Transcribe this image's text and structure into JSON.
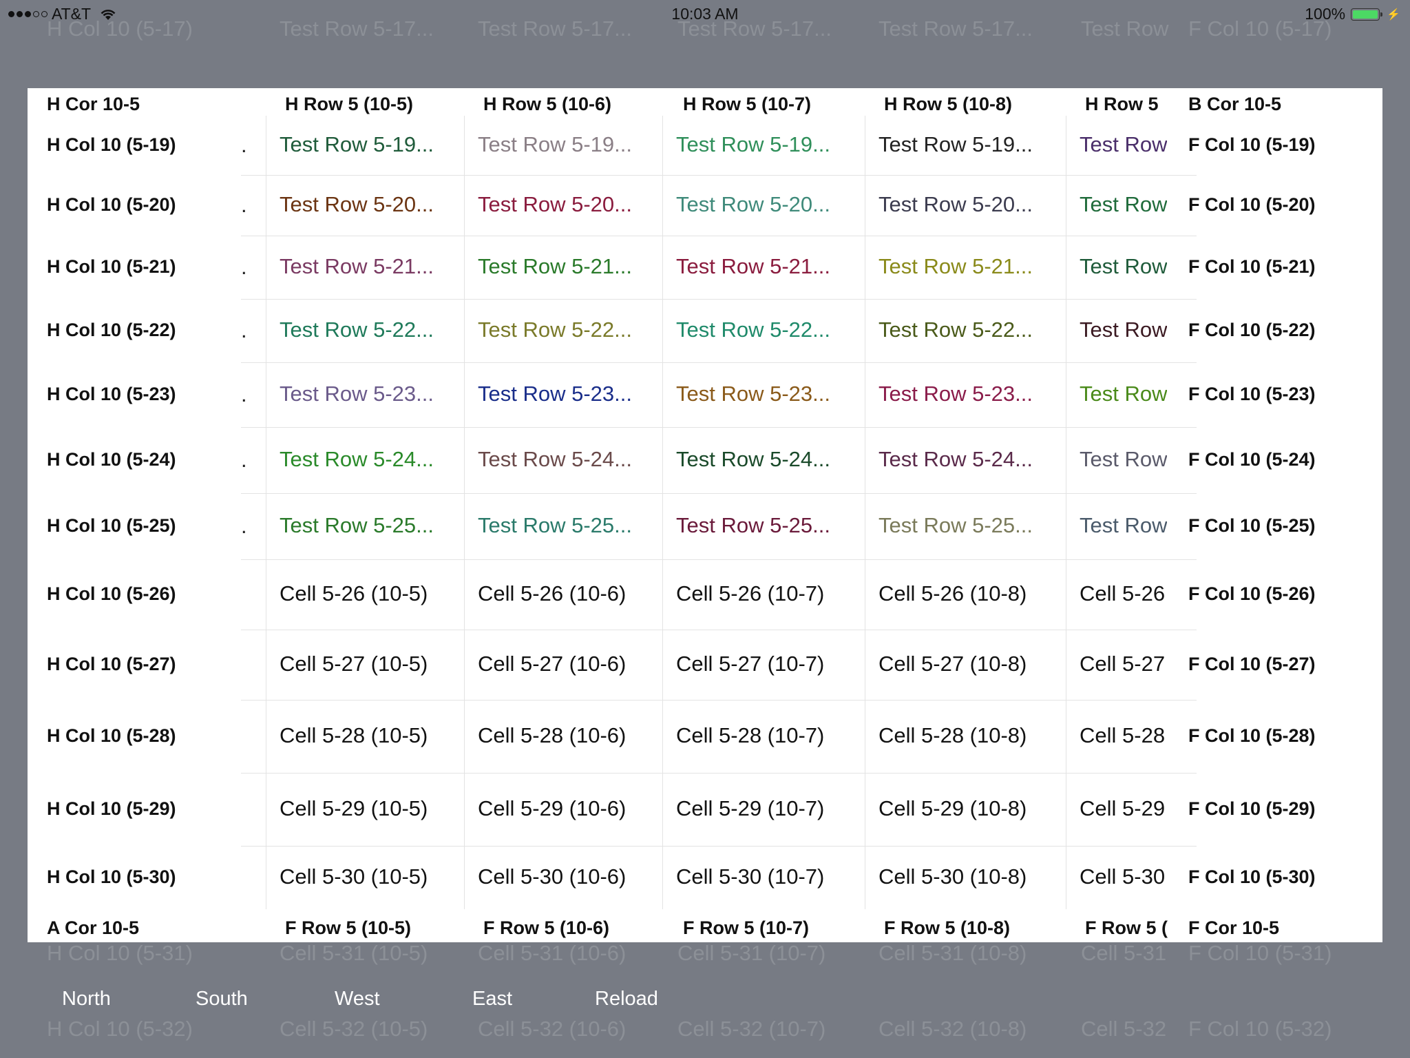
{
  "status": {
    "carrier": "AT&T",
    "time": "10:03 AM",
    "battery": "100%"
  },
  "ghost": {
    "top_left": "H Col 10 (5-17)",
    "top_cells": [
      "Test Row 5-17...",
      "Test Row 5-17...",
      "Test Row 5-17...",
      "Test Row 5-17..."
    ],
    "top_partial": "Test Row",
    "top_right": "F Col 10 (5-17)",
    "bottom1_left": "H Col 10 (5-31)",
    "bottom1_cells": [
      "Cell 5-31 (10-5)",
      "Cell 5-31 (10-6)",
      "Cell 5-31 (10-7)",
      "Cell 5-31 (10-8)"
    ],
    "bottom1_partial": "Cell 5-31",
    "bottom1_right": "F Col 10 (5-31)",
    "bottom2_left": "H Col 10 (5-32)",
    "bottom2_cells": [
      "Cell 5-32 (10-5)",
      "Cell 5-32 (10-6)",
      "Cell 5-32 (10-7)",
      "Cell 5-32 (10-8)"
    ],
    "bottom2_partial": "Cell 5-32",
    "bottom2_right": "F Col 10 (5-32)"
  },
  "grid": {
    "top_left_corner": "H Cor 10-5",
    "top_right_corner": "B Cor 10-5",
    "bottom_left_corner": "A Cor 10-5",
    "bottom_right_corner": "F Cor 10-5",
    "header_columns": [
      "H Row 5 (10-5)",
      "H Row 5 (10-6)",
      "H Row 5 (10-7)",
      "H Row 5 (10-8)",
      "H Row 5"
    ],
    "footer_columns": [
      "F Row 5 (10-5)",
      "F Row 5 (10-6)",
      "F Row 5 (10-7)",
      "F Row 5 (10-8)",
      "F Row 5 ("
    ],
    "row_headers": [
      "H Col 10 (5-19)",
      "H Col 10 (5-20)",
      "H Col 10 (5-21)",
      "H Col 10 (5-22)",
      "H Col 10 (5-23)",
      "H Col 10 (5-24)",
      "H Col 10 (5-25)",
      "H Col 10 (5-26)",
      "H Col 10 (5-27)",
      "H Col 10 (5-28)",
      "H Col 10 (5-29)",
      "H Col 10 (5-30)"
    ],
    "row_footers": [
      "F Col 10 (5-19)",
      "F Col 10 (5-20)",
      "F Col 10 (5-21)",
      "F Col 10 (5-22)",
      "F Col 10 (5-23)",
      "F Col 10 (5-24)",
      "F Col 10 (5-25)",
      "F Col 10 (5-26)",
      "F Col 10 (5-27)",
      "F Col 10 (5-28)",
      "F Col 10 (5-29)",
      "F Col 10 (5-30)"
    ],
    "rows": [
      {
        "cells": [
          "Test Row 5-19...",
          "Test Row 5-19...",
          "Test Row 5-19...",
          "Test Row 5-19...",
          "Test Row"
        ],
        "colors": [
          "#1f5b3a",
          "#8a7f86",
          "#2f8f5a",
          "#222222",
          "#4a2e6a"
        ]
      },
      {
        "cells": [
          "Test Row 5-20...",
          "Test Row 5-20...",
          "Test Row 5-20...",
          "Test Row 5-20...",
          "Test Row"
        ],
        "colors": [
          "#6b3412",
          "#8a1c3e",
          "#3f8a7a",
          "#3b3b4e",
          "#1f6b3a"
        ]
      },
      {
        "cells": [
          "Test Row 5-21...",
          "Test Row 5-21...",
          "Test Row 5-21...",
          "Test Row 5-21...",
          "Test Row"
        ],
        "colors": [
          "#7a3a62",
          "#2a7a2a",
          "#8a1c3e",
          "#8a8a1a",
          "#1f5b3a"
        ]
      },
      {
        "cells": [
          "Test Row 5-22...",
          "Test Row 5-22...",
          "Test Row 5-22...",
          "Test Row 5-22...",
          "Test Row"
        ],
        "colors": [
          "#1f7a5a",
          "#7a7a2a",
          "#1f8a6a",
          "#4a5a1a",
          "#3b1a22"
        ]
      },
      {
        "cells": [
          "Test Row 5-23...",
          "Test Row 5-23...",
          "Test Row 5-23...",
          "Test Row 5-23...",
          "Test Row"
        ],
        "colors": [
          "#6a5a8a",
          "#1a2e8a",
          "#8a5a1a",
          "#8a1c4a",
          "#4a8a1a"
        ]
      },
      {
        "cells": [
          "Test Row 5-24...",
          "Test Row 5-24...",
          "Test Row 5-24...",
          "Test Row 5-24...",
          "Test Row"
        ],
        "colors": [
          "#2a8a2a",
          "#6a4a4a",
          "#1a4a2a",
          "#5a2a4a",
          "#5a5a6a"
        ]
      },
      {
        "cells": [
          "Test Row 5-25...",
          "Test Row 5-25...",
          "Test Row 5-25...",
          "Test Row 5-25...",
          "Test Row"
        ],
        "colors": [
          "#2a7a2a",
          "#2a7a6a",
          "#6a1a3a",
          "#7a7a5a",
          "#4a5a6a"
        ]
      },
      {
        "cells": [
          "Cell 5-26 (10-5)",
          "Cell 5-26 (10-6)",
          "Cell 5-26 (10-7)",
          "Cell 5-26 (10-8)",
          "Cell 5-26"
        ],
        "colors": [
          "#111111",
          "#111111",
          "#111111",
          "#111111",
          "#111111"
        ]
      },
      {
        "cells": [
          "Cell 5-27 (10-5)",
          "Cell 5-27 (10-6)",
          "Cell 5-27 (10-7)",
          "Cell 5-27 (10-8)",
          "Cell 5-27"
        ],
        "colors": [
          "#111111",
          "#111111",
          "#111111",
          "#111111",
          "#111111"
        ]
      },
      {
        "cells": [
          "Cell 5-28 (10-5)",
          "Cell 5-28 (10-6)",
          "Cell 5-28 (10-7)",
          "Cell 5-28 (10-8)",
          "Cell 5-28"
        ],
        "colors": [
          "#111111",
          "#111111",
          "#111111",
          "#111111",
          "#111111"
        ]
      },
      {
        "cells": [
          "Cell 5-29 (10-5)",
          "Cell 5-29 (10-6)",
          "Cell 5-29 (10-7)",
          "Cell 5-29 (10-8)",
          "Cell 5-29"
        ],
        "colors": [
          "#111111",
          "#111111",
          "#111111",
          "#111111",
          "#111111"
        ]
      },
      {
        "cells": [
          "Cell 5-30 (10-5)",
          "Cell 5-30 (10-6)",
          "Cell 5-30 (10-7)",
          "Cell 5-30 (10-8)",
          "Cell 5-30"
        ],
        "colors": [
          "#111111",
          "#111111",
          "#111111",
          "#111111",
          "#111111"
        ]
      }
    ],
    "frozen_marker": "."
  },
  "toolbar": {
    "north": "North",
    "south": "South",
    "west": "West",
    "east": "East",
    "reload": "Reload"
  }
}
